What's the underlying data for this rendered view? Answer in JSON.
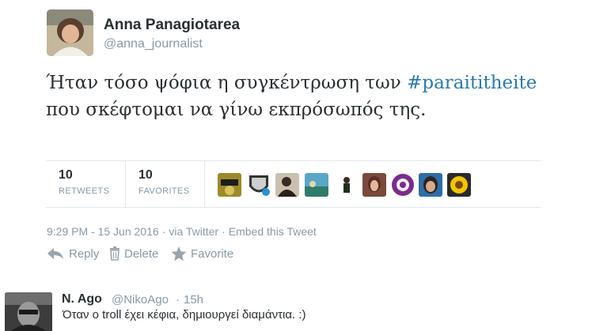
{
  "tweet": {
    "display_name": "Anna Panagiotarea",
    "handle": "@anna_journalist",
    "text_before": "Ήταν τόσο ψόφια η συγκέντρωση των ",
    "hashtag": "#paraititheite",
    "text_after": " που σκέφτομαι να γίνω εκπρόσωπός της.",
    "stats": {
      "retweets_count": "10",
      "retweets_label": "RETWEETS",
      "favorites_count": "10",
      "favorites_label": "FAVORITES"
    },
    "meta": {
      "timestamp": "9:29 PM - 15 Jun 2016",
      "separator": "·",
      "client": "via Twitter",
      "embed": "Embed this Tweet"
    },
    "actions": {
      "reply": "Reply",
      "delete": "Delete",
      "favorite": "Favorite"
    },
    "colors": {
      "hashtag": "#2a7ab0",
      "muted": "#8899a6",
      "text": "#292f33"
    }
  },
  "reply": {
    "display_name": "N. Ago",
    "handle": "@NikoAgo",
    "dot": "·",
    "time": "15h",
    "text": "Όταν ο troll έχει κέφια, δημιουργεί διαμάντια. :)"
  },
  "icons": [
    "reply-icon",
    "trash-icon",
    "star-icon"
  ]
}
